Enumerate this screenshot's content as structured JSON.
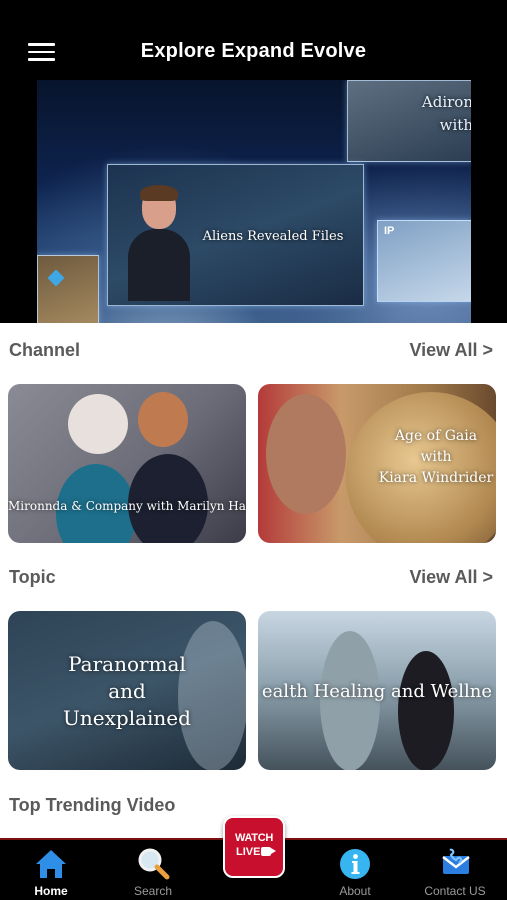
{
  "header": {
    "title": "Explore Expand Evolve",
    "menu_icon": "hamburger-menu-icon"
  },
  "hero": {
    "caption": "Aliens Revealed Files",
    "side_caption_line1": "Adiron",
    "side_caption_line2": "with",
    "ip_tag": "IP"
  },
  "channel": {
    "title": "Channel",
    "view_all": "View All >",
    "cards": [
      {
        "label": "Mironnda & Company with Marilyn Har"
      },
      {
        "label_line1": "Age of Gaia",
        "label_line2": "with",
        "label_line3": "Kiara Windrider"
      }
    ]
  },
  "topic": {
    "title": "Topic",
    "view_all": "View All >",
    "cards": [
      {
        "label_line1": "Paranormal",
        "label_line2": "and",
        "label_line3": "Unexplained"
      },
      {
        "label": "ealth Healing and Wellne"
      }
    ]
  },
  "trending": {
    "title": "Top Trending Video"
  },
  "watch_live": {
    "line1": "WATCH",
    "line2": "LIVE"
  },
  "tabs": [
    {
      "label": "Home",
      "icon": "home-icon",
      "active": true
    },
    {
      "label": "Search",
      "icon": "search-icon"
    },
    {
      "label": "About",
      "icon": "info-icon"
    },
    {
      "label": "Contact US",
      "icon": "contact-icon"
    }
  ],
  "colors": {
    "accent": "#1a73e8",
    "live_red": "#c8102e",
    "header_bg": "#000000"
  }
}
